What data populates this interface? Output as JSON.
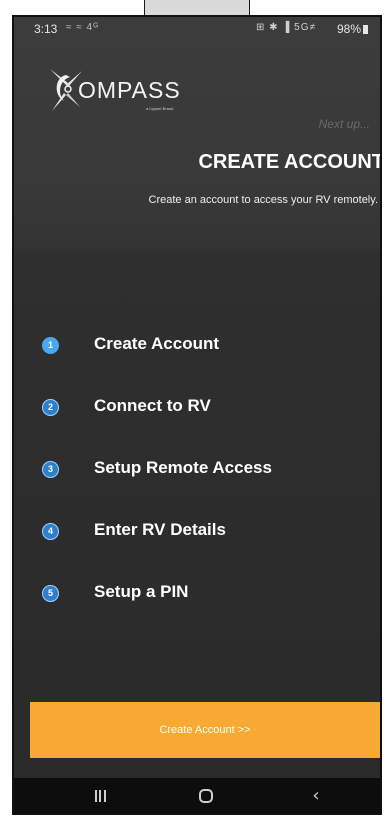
{
  "status_bar": {
    "time": "3:13",
    "left_icons": "≈ ≈ 4ᴳ",
    "right_icons": "⊞ ✱ ▐ 5G≠",
    "battery": "98%"
  },
  "logo": {
    "text": "OMPASS",
    "sub": "a Lippert Brand"
  },
  "header": {
    "next_up": "Next up...",
    "title": "CREATE ACCOUNT",
    "description": "Create an account to access your RV remotely."
  },
  "steps": [
    {
      "number": "1",
      "label": "Create Account"
    },
    {
      "number": "2",
      "label": "Connect to RV"
    },
    {
      "number": "3",
      "label": "Setup Remote Access"
    },
    {
      "number": "4",
      "label": "Enter RV Details"
    },
    {
      "number": "5",
      "label": "Setup a PIN"
    }
  ],
  "cta": {
    "label": "Create Account >>"
  },
  "navbar": {
    "recent": "recent-apps-icon",
    "home": "home-icon",
    "back": "back-icon"
  },
  "colors": {
    "accent": "#f7a933",
    "step_badge": "#2f80c8",
    "step_badge_active": "#4aa8f0",
    "background": "#2e2e2e"
  }
}
